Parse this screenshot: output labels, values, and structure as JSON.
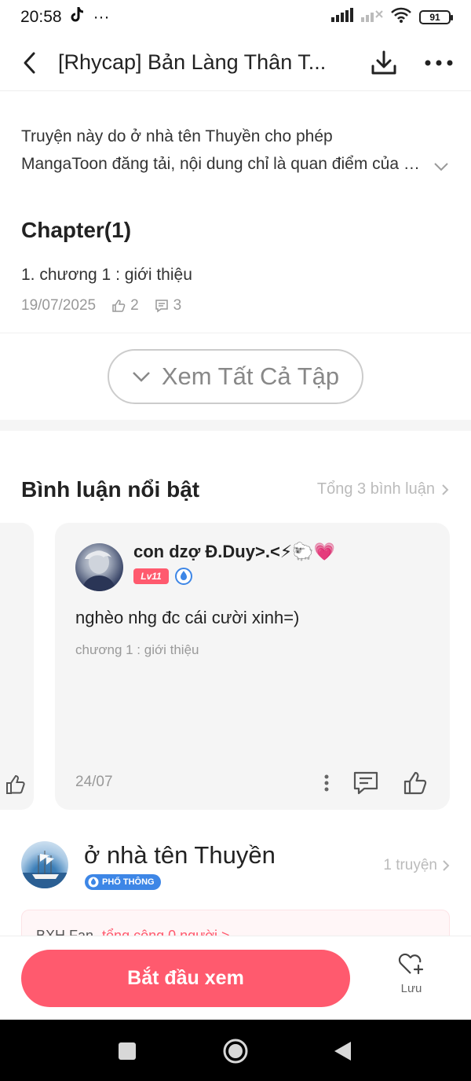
{
  "status_bar": {
    "time": "20:58",
    "extra": "···",
    "battery": "91"
  },
  "header": {
    "title": "[Rhycap] Bản Làng Thân T..."
  },
  "description": {
    "line1": "Truyện này do ở nhà tên Thuyền  cho phép",
    "line2": "MangaToon đăng tải, nội dung chỉ là quan điểm của tác giả"
  },
  "chapters": {
    "section_title": "Chapter(1)",
    "items": [
      {
        "name": "1. chương 1 : giới thiệu",
        "date": "19/07/2025",
        "likes": "2",
        "comments": "3"
      }
    ],
    "see_all_label": "Xem Tất Cả Tập"
  },
  "comments": {
    "section_title": "Bình luận nổi bật",
    "total_label": "Tổng 3 bình luận",
    "featured": {
      "user_name": "con dzợ Đ.Duy>.<⚡🐑💗",
      "level": "Lv11",
      "text": "nghèo nhg đc cái cười xinh=)",
      "chapter": "chương 1 : giới thiệu",
      "date": "24/07"
    }
  },
  "author": {
    "name": "ở nhà tên Thuyền",
    "badge": "PHỔ THÔNG",
    "story_count": "1 truyện"
  },
  "fan_box": {
    "label": "BXH Fan",
    "link": "tổng cộng 0 người >"
  },
  "bottom": {
    "start_label": "Bắt đầu xem",
    "save_label": "Lưu"
  },
  "colors": {
    "accent": "#ff5a6e",
    "muted": "#999999",
    "badge_blue": "#3d86e6"
  }
}
